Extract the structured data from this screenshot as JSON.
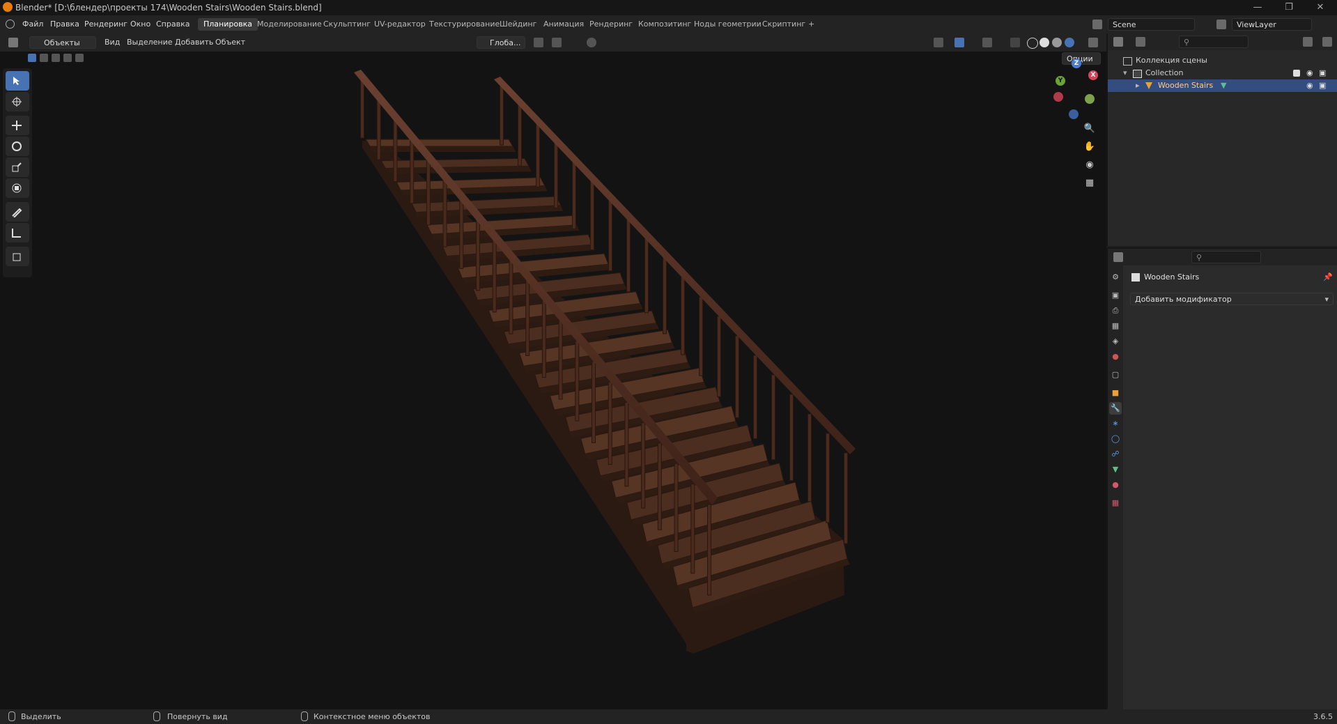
{
  "window": {
    "title": "Blender* [D:\\блендер\\проекты 174\\Wooden Stairs\\Wooden Stairs.blend]"
  },
  "menu": {
    "items": [
      "Файл",
      "Правка",
      "Рендеринг",
      "Окно",
      "Справка"
    ]
  },
  "workspaces": {
    "tabs": [
      "Планировка",
      "Моделирование",
      "Скульптинг",
      "UV-редактор",
      "Текстурирование",
      "Шейдинг",
      "Анимация",
      "Рендеринг",
      "Композитинг",
      "Ноды геометрии",
      "Скриптинг"
    ],
    "active": "Планировка",
    "add_label": "+"
  },
  "scene": {
    "name": "Scene",
    "view_layer": "ViewLayer"
  },
  "viewport_header": {
    "mode": "Объекты",
    "menus": [
      "Вид",
      "Выделение",
      "Добавить",
      "Объект"
    ],
    "orientation": "Глоба...",
    "options_label": "Опции"
  },
  "gizmo": {
    "x_label": "X",
    "y_label": "Y",
    "z_label": "Z"
  },
  "outliner": {
    "root": "Коллекция сцены",
    "collection": "Collection",
    "object": "Wooden Stairs"
  },
  "properties": {
    "object_name": "Wooden Stairs",
    "add_modifier_label": "Добавить модификатор"
  },
  "statusbar": {
    "select_label": "Выделить",
    "rotate_label": "Повернуть вид",
    "context_label": "Контекстное меню объектов",
    "version": "3.6.5"
  },
  "colors": {
    "accent": "#4772b3",
    "selection": "#334d80",
    "object_orange": "#e8a13a",
    "wood_dark": "#3a2419",
    "wood_light": "#5e3a28"
  }
}
